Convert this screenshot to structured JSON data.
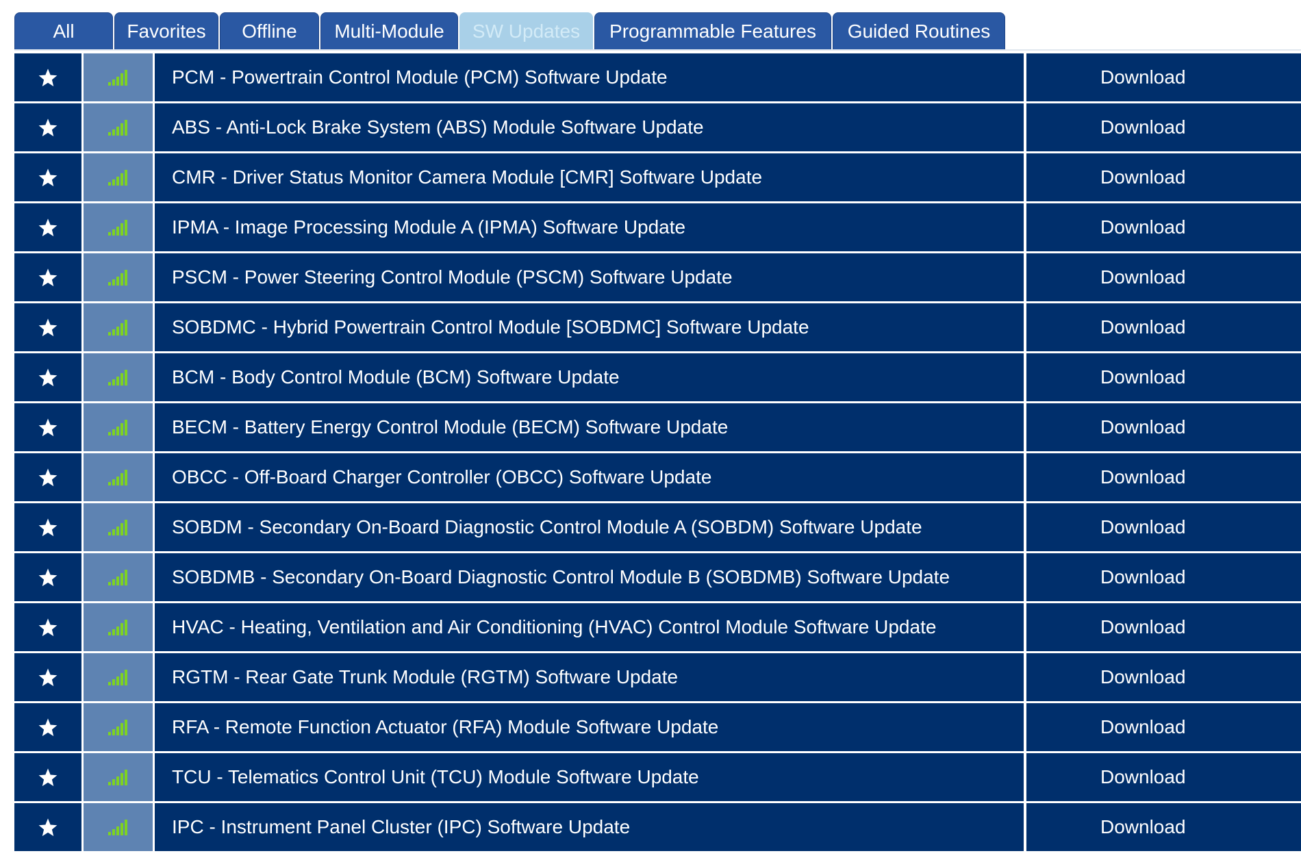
{
  "tabs": [
    {
      "label": "All",
      "active": false
    },
    {
      "label": "Favorites",
      "active": false
    },
    {
      "label": "Offline",
      "active": false
    },
    {
      "label": "Multi-Module",
      "active": false
    },
    {
      "label": "SW Updates",
      "active": true
    },
    {
      "label": "Programmable Features",
      "active": false
    },
    {
      "label": "Guided Routines",
      "active": false
    }
  ],
  "icons": {
    "favorite": "star-icon",
    "signal": "signal-strength-icon"
  },
  "colors": {
    "tab_bg": "#2a58a3",
    "tab_active_bg": "#a9d0e8",
    "row_bg": "#002f6c",
    "signal_cell_bg": "#5e83b2",
    "signal_bars": "#7ed321"
  },
  "rows": [
    {
      "name": "PCM - Powertrain Control Module (PCM) Software Update",
      "action": "Download"
    },
    {
      "name": "ABS - Anti-Lock Brake System (ABS) Module Software Update",
      "action": "Download"
    },
    {
      "name": "CMR - Driver Status Monitor Camera Module [CMR] Software Update",
      "action": "Download"
    },
    {
      "name": "IPMA - Image Processing Module A (IPMA) Software Update",
      "action": "Download"
    },
    {
      "name": "PSCM - Power Steering Control Module (PSCM) Software Update",
      "action": "Download"
    },
    {
      "name": "SOBDMC - Hybrid Powertrain Control Module [SOBDMC] Software Update",
      "action": "Download"
    },
    {
      "name": "BCM - Body Control Module (BCM) Software Update",
      "action": "Download"
    },
    {
      "name": "BECM - Battery Energy Control Module (BECM) Software Update",
      "action": "Download"
    },
    {
      "name": "OBCC - Off-Board Charger Controller (OBCC) Software Update",
      "action": "Download"
    },
    {
      "name": "SOBDM - Secondary On-Board Diagnostic Control Module A (SOBDM) Software Update",
      "action": "Download"
    },
    {
      "name": "SOBDMB - Secondary On-Board Diagnostic Control Module B (SOBDMB) Software Update",
      "action": "Download"
    },
    {
      "name": "HVAC - Heating, Ventilation and Air Conditioning (HVAC) Control Module Software Update",
      "action": "Download"
    },
    {
      "name": "RGTM - Rear Gate Trunk Module (RGTM) Software Update",
      "action": "Download"
    },
    {
      "name": "RFA - Remote Function Actuator (RFA) Module Software Update",
      "action": "Download"
    },
    {
      "name": "TCU - Telematics Control Unit (TCU) Module Software Update",
      "action": "Download"
    },
    {
      "name": "IPC - Instrument Panel Cluster (IPC) Software Update",
      "action": "Download"
    }
  ]
}
